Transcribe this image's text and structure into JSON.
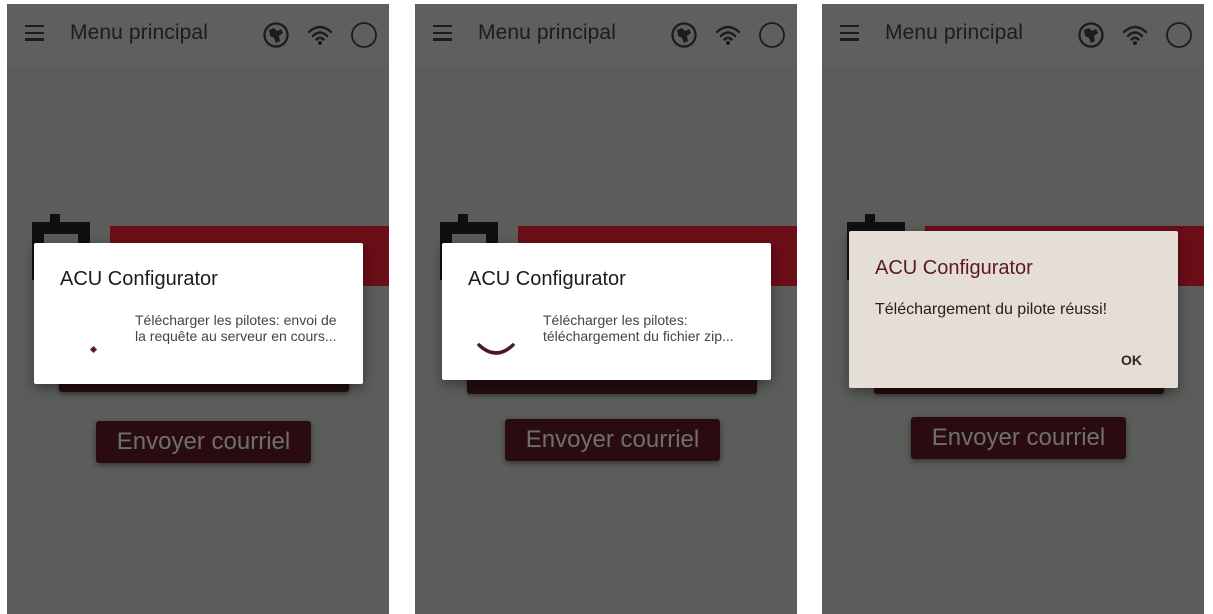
{
  "app_bar": {
    "title": "Menu principal",
    "menu_icon": "hamburger-menu-icon",
    "status_icons": [
      "globe-icon",
      "wifi-icon",
      "circle-status-icon"
    ]
  },
  "background": {
    "send_email_label": "Envoyer courriel"
  },
  "screens": [
    {
      "dialog_title": "ACU Configurator",
      "dialog_message": "Télécharger les pilotes: envoi de la requête au serveur en cours..."
    },
    {
      "dialog_title": "ACU Configurator",
      "dialog_message": "Télécharger les pilotes: téléchargement du fichier zip..."
    },
    {
      "dialog_title": "ACU Configurator",
      "dialog_message": "Téléchargement du pilote réussi!",
      "ok_label": "OK"
    }
  ],
  "colors": {
    "brand_red": "#7a0c17",
    "overlay_grey": "#5b5d5a",
    "button_dark": "#2a0c10"
  }
}
